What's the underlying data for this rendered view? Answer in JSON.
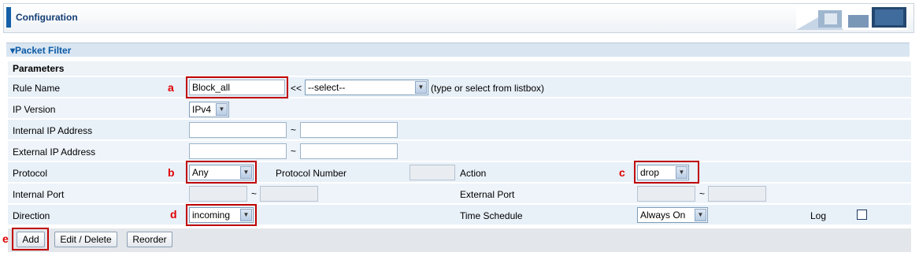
{
  "header": {
    "title": "Configuration"
  },
  "section": {
    "title": "▾Packet Filter",
    "params_label": "Parameters"
  },
  "rows": {
    "rule_name": {
      "label": "Rule Name",
      "value": "Block_all",
      "prefix": "<<",
      "select": "--select--",
      "hint": "(type or select from listbox)"
    },
    "ip_version": {
      "label": "IP Version",
      "value": "IPv4"
    },
    "internal_ip": {
      "label": "Internal IP Address",
      "sep": "~"
    },
    "external_ip": {
      "label": "External IP Address",
      "sep": "~"
    },
    "protocol": {
      "label": "Protocol",
      "value": "Any",
      "number_label": "Protocol Number",
      "action_label": "Action",
      "action_value": "drop"
    },
    "ports": {
      "internal_label": "Internal Port",
      "external_label": "External Port",
      "sep": "~"
    },
    "direction": {
      "label": "Direction",
      "value": "incoming",
      "schedule_label": "Time Schedule",
      "schedule_value": "Always On",
      "log_label": "Log"
    }
  },
  "markers": {
    "a": "a",
    "b": "b",
    "c": "c",
    "d": "d",
    "e": "e"
  },
  "buttons": {
    "add": "Add",
    "edit_delete": "Edit / Delete",
    "reorder": "Reorder"
  },
  "colors": {
    "accent": "#1460a8",
    "marker": "#e00000",
    "section_bg": "#d9e6f2"
  }
}
